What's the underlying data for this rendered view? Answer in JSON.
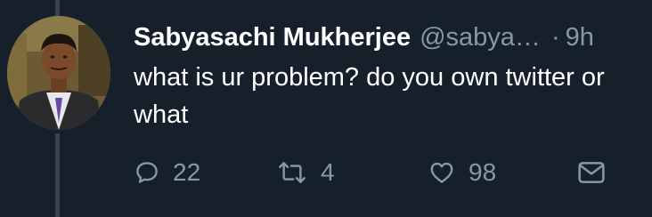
{
  "tweet": {
    "display_name": "Sabyasachi Mukherjee",
    "handle": "@sabya…",
    "separator": "·",
    "time": "9h",
    "text": "what is ur problem? do you own twitter or what"
  },
  "actions": {
    "reply": {
      "icon": "reply-icon",
      "count": "22"
    },
    "retweet": {
      "icon": "retweet-icon",
      "count": "4"
    },
    "like": {
      "icon": "heart-icon",
      "count": "98"
    },
    "message": {
      "icon": "envelope-icon"
    }
  },
  "colors": {
    "background": "#15202b",
    "text_primary": "#ffffff",
    "text_secondary": "#8899a6",
    "thread_line": "#38444d"
  }
}
